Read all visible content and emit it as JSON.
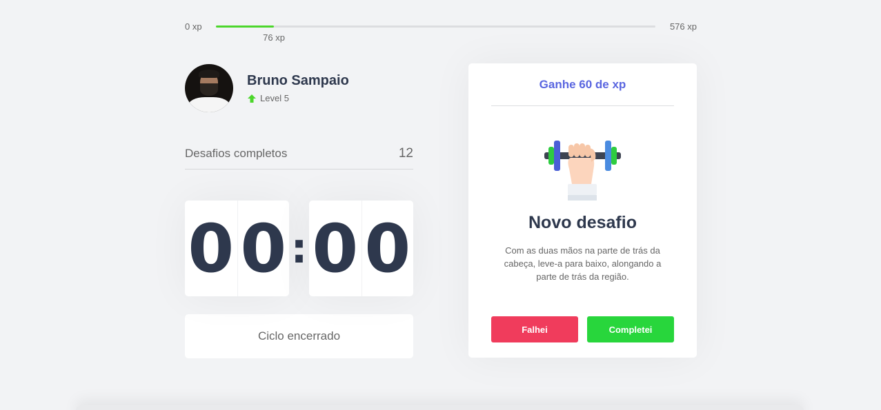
{
  "experience": {
    "min_label": "0 xp",
    "max_label": "576 xp",
    "current_label": "76 xp",
    "current_fraction": 0.132,
    "fill_color": "#4cd62b"
  },
  "profile": {
    "name": "Bruno Sampaio",
    "level_label": "Level 5",
    "level_icon": "level-up-arrow-icon"
  },
  "completed": {
    "label": "Desafios completos",
    "count": "12"
  },
  "countdown": {
    "minute_left": "0",
    "minute_right": "0",
    "separator": ":",
    "second_left": "0",
    "second_right": "0"
  },
  "cycle_button": {
    "label": "Ciclo encerrado"
  },
  "challenge": {
    "header": "Ganhe 60 de xp",
    "icon": "dumbbell-hand-icon",
    "title": "Novo desafio",
    "description": "Com as duas mãos na parte de trás da cabeça, leve-a para baixo, alongando a parte de trás da região.",
    "fail_label": "Falhei",
    "success_label": "Completei",
    "header_color": "#5965e0",
    "fail_color": "#f03c5c",
    "success_color": "#28d63c"
  }
}
